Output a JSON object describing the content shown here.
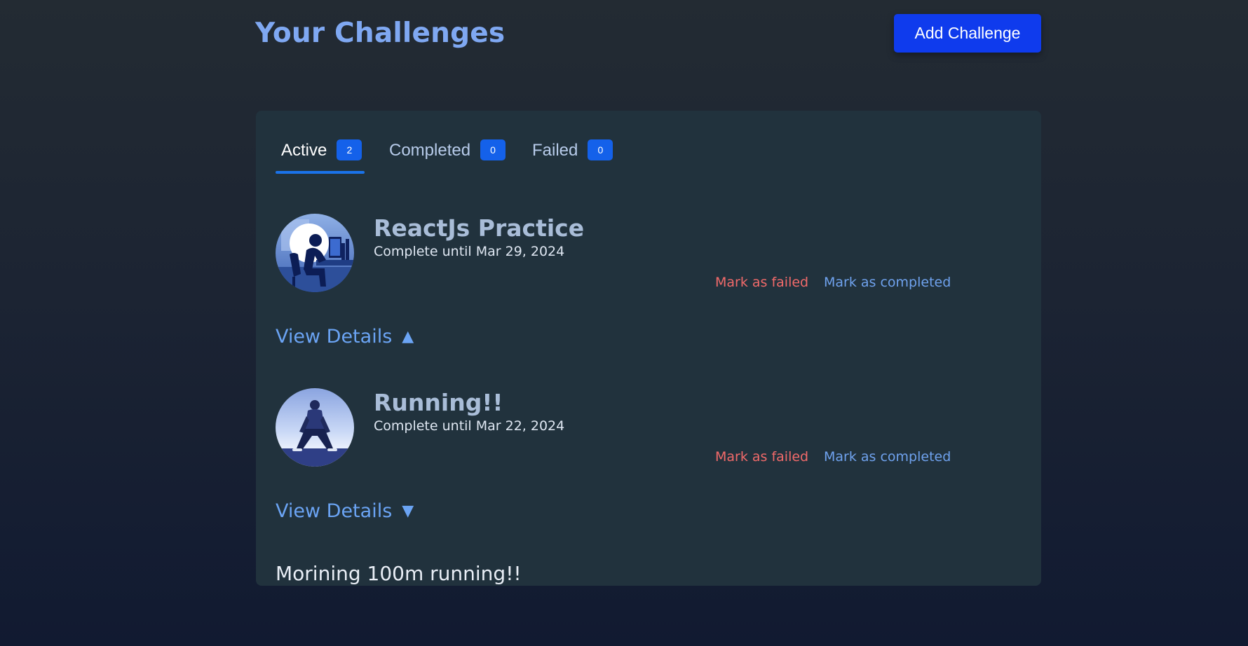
{
  "header": {
    "title": "Your Challenges",
    "add_button_label": "Add Challenge"
  },
  "tabs": [
    {
      "label": "Active",
      "count": "2",
      "active": true
    },
    {
      "label": "Completed",
      "count": "0",
      "active": false
    },
    {
      "label": "Failed",
      "count": "0",
      "active": false
    }
  ],
  "challenges": [
    {
      "title": "ReactJs Practice",
      "deadline": "Complete until Mar 29, 2024",
      "mark_failed_label": "Mark as failed",
      "mark_completed_label": "Mark as completed",
      "view_details_label": "View Details",
      "view_details_arrow": "▲",
      "image_icon": "person-at-computer-icon"
    },
    {
      "title": "Running!!",
      "deadline": "Complete until Mar 22, 2024",
      "mark_failed_label": "Mark as failed",
      "mark_completed_label": "Mark as completed",
      "view_details_label": "View Details",
      "view_details_arrow": "▼",
      "image_icon": "person-stretching-icon",
      "description": "Morining 100m running!!"
    }
  ],
  "colors": {
    "title_accent": "#7fa8f2",
    "primary_button": "#0f3bed",
    "badge": "#1461ea",
    "fail_action": "#f16a6a",
    "complete_action": "#6fa2ee",
    "panel": "#21323d"
  }
}
